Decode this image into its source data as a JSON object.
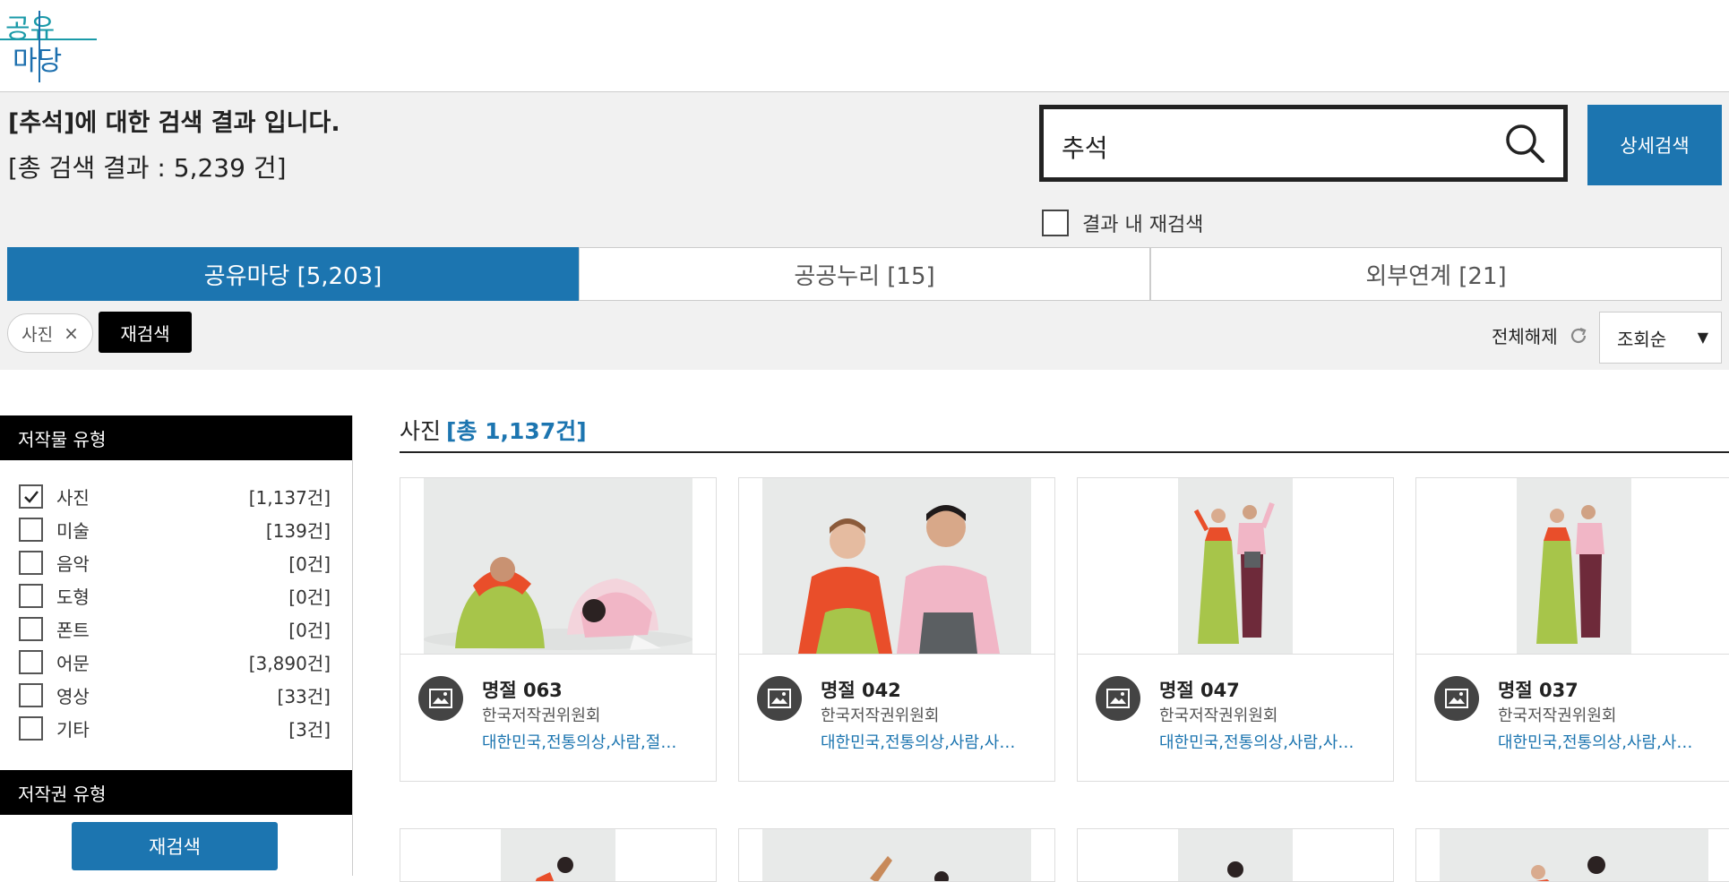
{
  "header": {
    "logo_text": "공유마당",
    "logo_lines": [
      "공유",
      "마당"
    ]
  },
  "result": {
    "title": "[추석]에 대한 검색 결과 입니다.",
    "count": "[총 검색 결과 : 5,239 건]"
  },
  "search": {
    "value": "추석",
    "advanced_label": "상세검색",
    "within_label": "결과 내 재검색"
  },
  "tabs": [
    {
      "label": "공유마당 [5,203]",
      "active": true
    },
    {
      "label": "공공누리 [15]",
      "active": false
    },
    {
      "label": "외부연계 [21]",
      "active": false
    }
  ],
  "filter_bar": {
    "chip_label": "사진",
    "chip_close": "×",
    "research_label": "재검색",
    "reset_label": "전체해제",
    "sort_value": "조회순",
    "sort_caret": "▼"
  },
  "sidebar": {
    "type_heading": "저작물 유형",
    "types": [
      {
        "label": "사진",
        "count": "[1,137건]",
        "checked": true
      },
      {
        "label": "미술",
        "count": "[139건]",
        "checked": false
      },
      {
        "label": "음악",
        "count": "[0건]",
        "checked": false
      },
      {
        "label": "도형",
        "count": "[0건]",
        "checked": false
      },
      {
        "label": "폰트",
        "count": "[0건]",
        "checked": false
      },
      {
        "label": "어문",
        "count": "[3,890건]",
        "checked": false
      },
      {
        "label": "영상",
        "count": "[33건]",
        "checked": false
      },
      {
        "label": "기타",
        "count": "[3건]",
        "checked": false
      }
    ],
    "license_heading": "저작권 유형",
    "research_button": "재검색"
  },
  "section": {
    "title": "사진",
    "total": "[총 1,137건]"
  },
  "cards": [
    {
      "title": "명절 063",
      "org": "한국저작권위원회",
      "tags": "대한민국,전통의상,사람,절…"
    },
    {
      "title": "명절 042",
      "org": "한국저작권위원회",
      "tags": "대한민국,전통의상,사람,사…"
    },
    {
      "title": "명절 047",
      "org": "한국저작권위원회",
      "tags": "대한민국,전통의상,사람,사…"
    },
    {
      "title": "명절 037",
      "org": "한국저작권위원회",
      "tags": "대한민국,전통의상,사람,사…"
    }
  ],
  "colors": {
    "accent": "#1c75b0",
    "black": "#000000",
    "band": "#f1f1f1",
    "logo_teal": "#1a9aa8",
    "logo_blue": "#1c6fae"
  },
  "icons": [
    "search-icon",
    "refresh-icon",
    "image-icon",
    "check-icon",
    "close-icon"
  ]
}
